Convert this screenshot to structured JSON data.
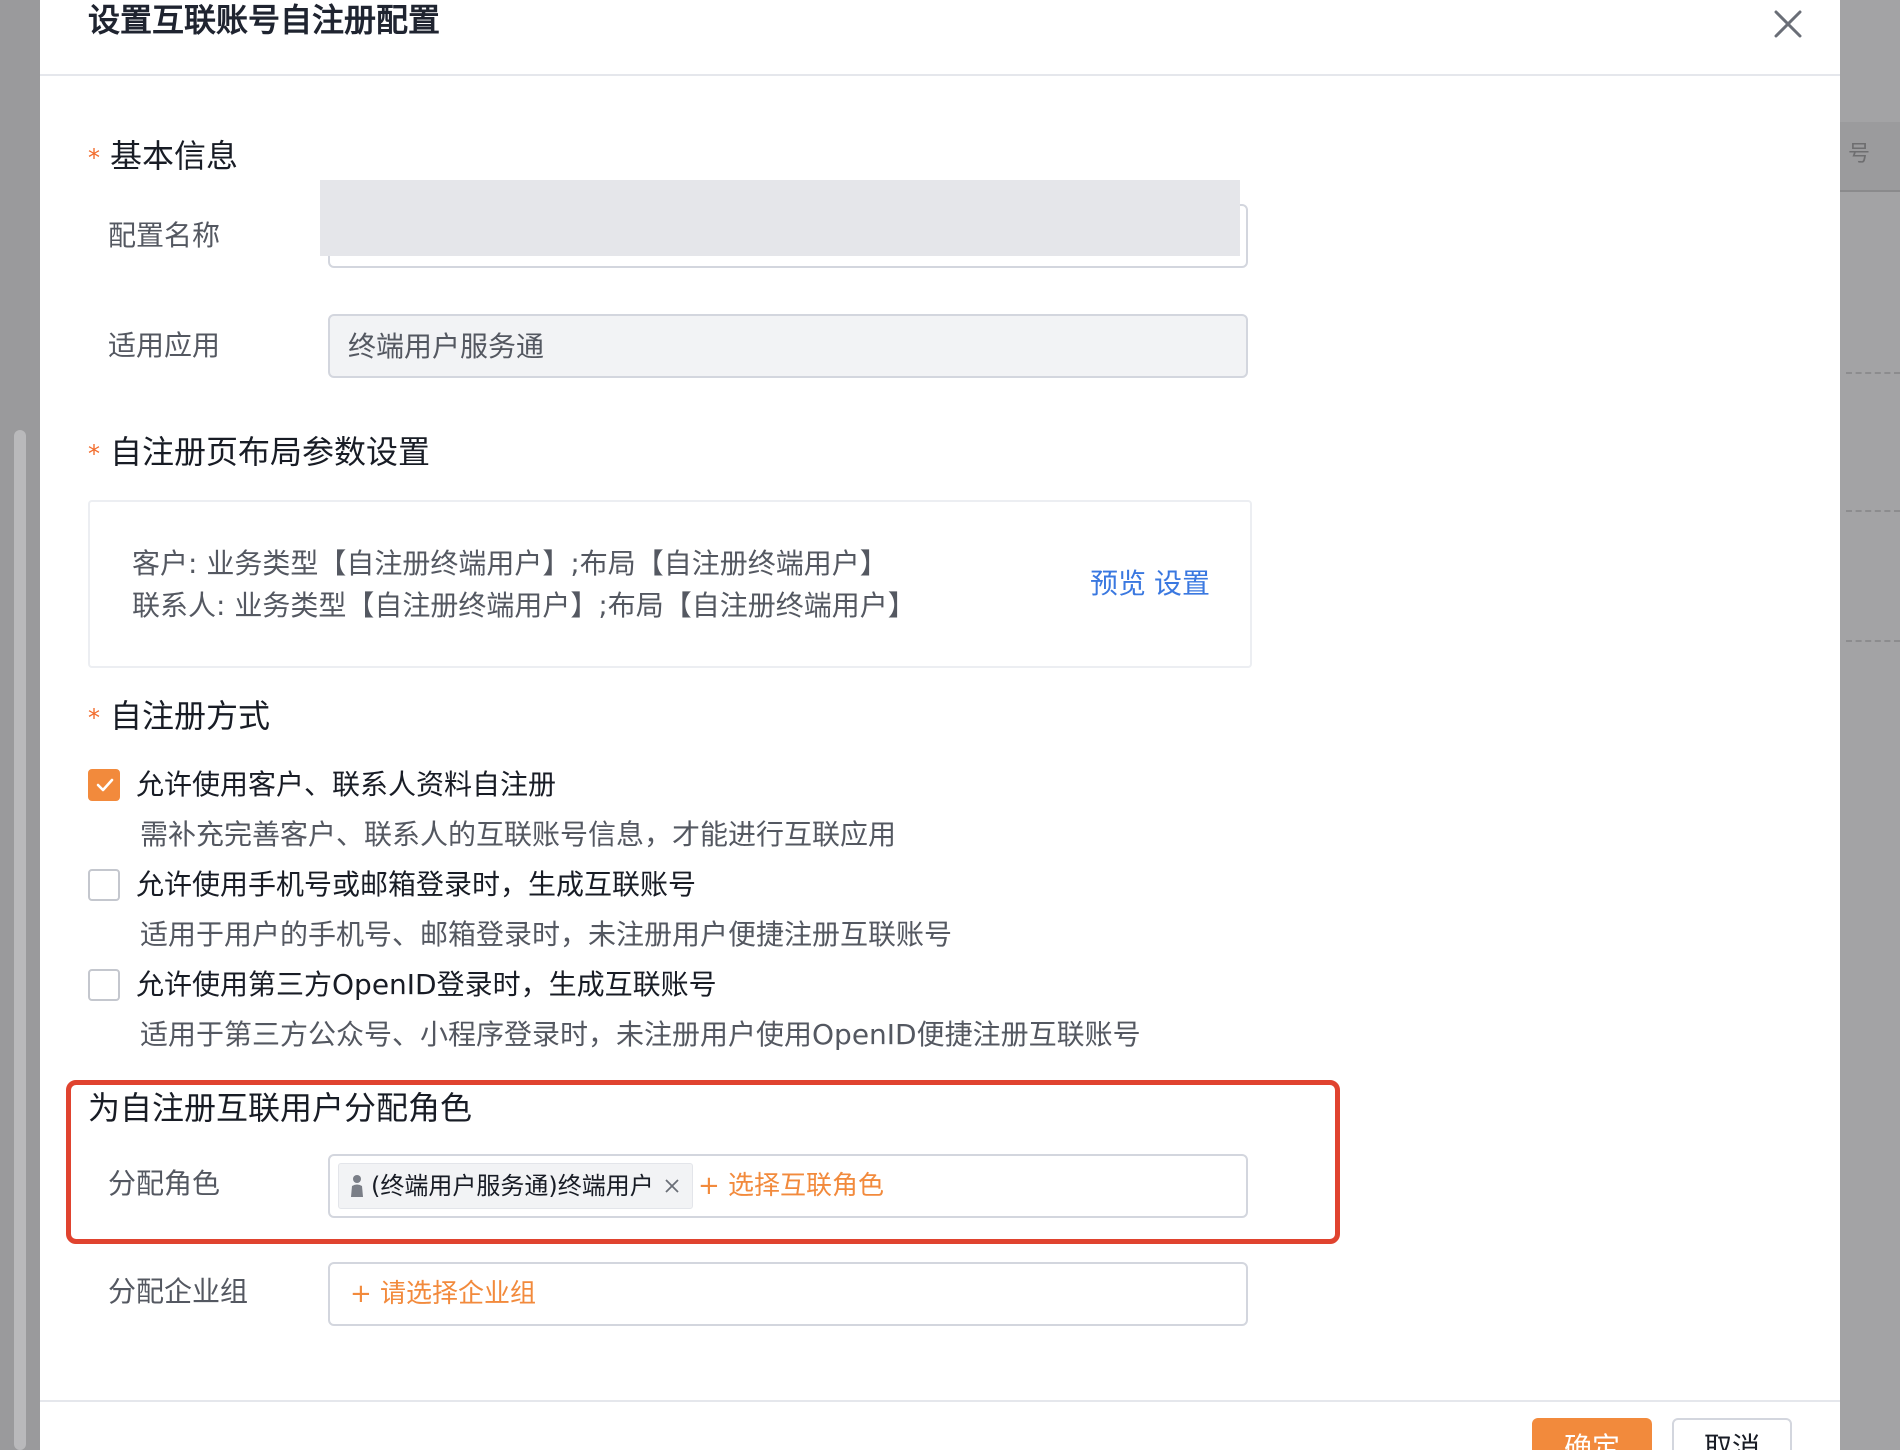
{
  "modal": {
    "title": "设置互联账号自注册配置"
  },
  "basic_info": {
    "title": "基本信息",
    "config_name_label": "配置名称",
    "config_name_value": "",
    "app_label": "适用应用",
    "app_value": "终端用户服务通"
  },
  "layout_settings": {
    "title": "自注册页布局参数设置",
    "lines": [
      "客户: 业务类型【自注册终端用户】;布局【自注册终端用户】",
      "联系人: 业务类型【自注册终端用户】;布局【自注册终端用户】"
    ],
    "preview_label": "预览",
    "settings_label": "设置"
  },
  "register_methods": {
    "title": "自注册方式",
    "options": [
      {
        "label": "允许使用客户、联系人资料自注册",
        "desc": "需补充完善客户、联系人的互联账号信息，才能进行互联应用",
        "checked": true
      },
      {
        "label": "允许使用手机号或邮箱登录时，生成互联账号",
        "desc": "适用于用户的手机号、邮箱登录时，未注册用户便捷注册互联账号",
        "checked": false
      },
      {
        "label": "允许使用第三方OpenID登录时，生成互联账号",
        "desc": "适用于第三方公众号、小程序登录时，未注册用户使用OpenID便捷注册互联账号",
        "checked": false
      }
    ]
  },
  "role_assign": {
    "title": "为自注册互联用户分配角色",
    "role_label": "分配角色",
    "role_tag": "(终端用户服务通)终端用户",
    "add_role": "+ 选择互联角色",
    "group_label": "分配企业组",
    "add_group": "+ 请选择企业组"
  },
  "footer": {
    "ok_label": "确定",
    "cancel_label": "取消"
  },
  "colors": {
    "accent_orange": "#f28a3c",
    "link_blue": "#3a78e0",
    "highlight_red": "#e0432f"
  }
}
